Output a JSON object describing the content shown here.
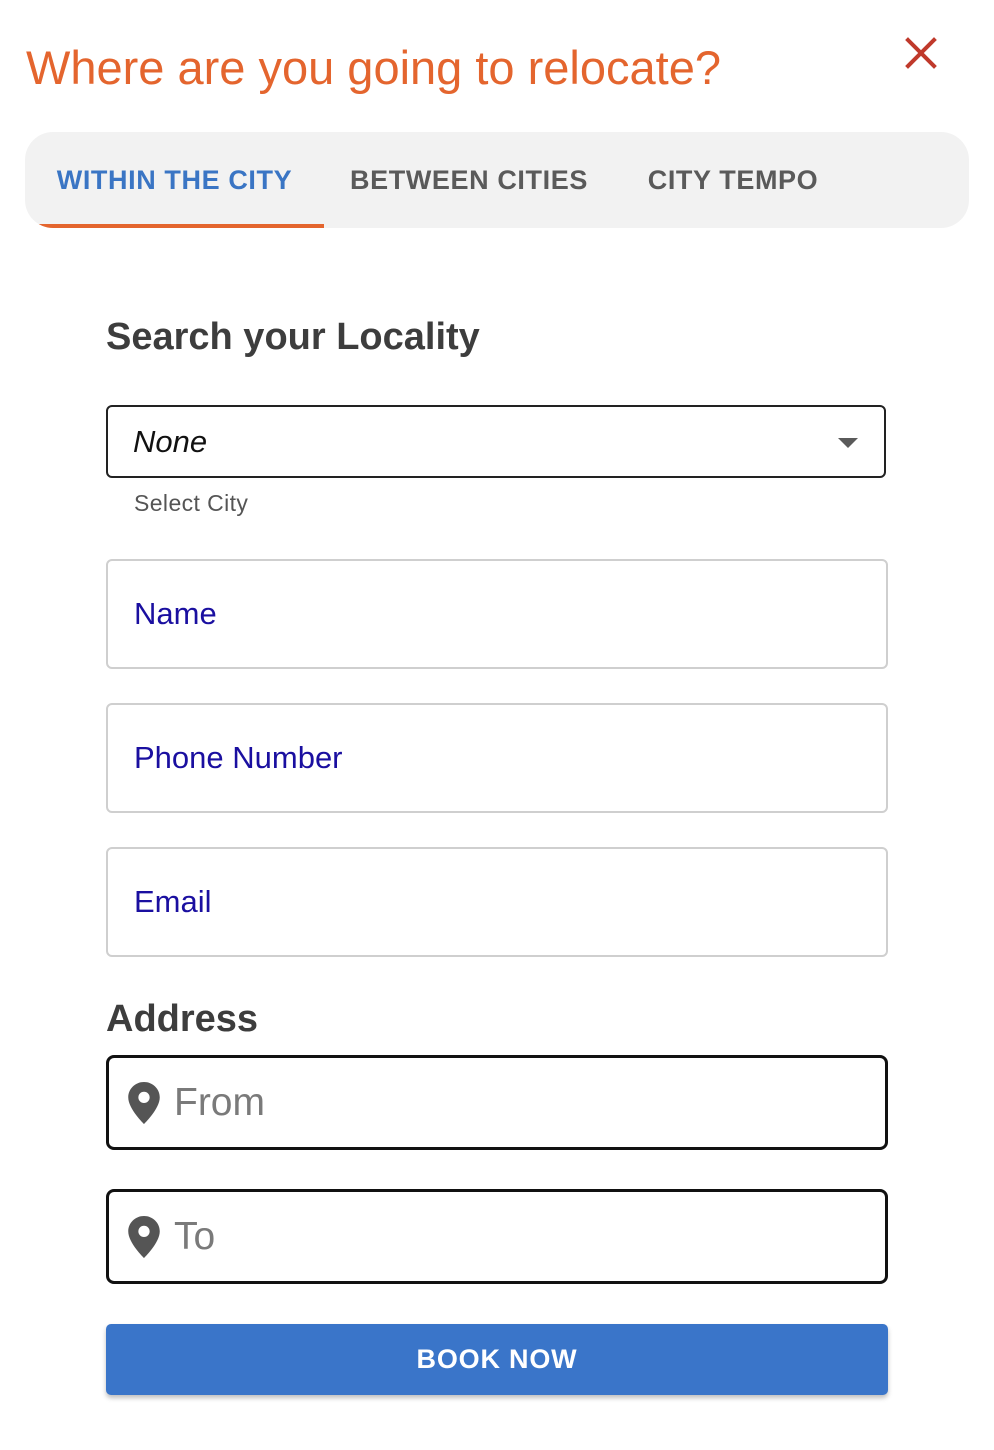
{
  "dialog": {
    "title": "Where are you going to relocate?",
    "close_icon": "close-icon"
  },
  "tabs": [
    {
      "label": "WITHIN THE CITY",
      "active": true
    },
    {
      "label": "BETWEEN CITIES",
      "active": false
    },
    {
      "label": "CITY TEMPO",
      "active": false
    }
  ],
  "locality": {
    "heading": "Search your Locality",
    "city_select": {
      "value": "None",
      "helper": "Select City",
      "icon": "chevron-down-icon"
    }
  },
  "contact_fields": {
    "name_label": "Name",
    "phone_label": "Phone Number",
    "email_label": "Email"
  },
  "address": {
    "heading": "Address",
    "from_placeholder": "From",
    "to_placeholder": "To",
    "icon": "map-pin-icon"
  },
  "actions": {
    "book_label": "BOOK NOW"
  },
  "colors": {
    "accent": "#e4652e",
    "primary": "#3a75c9",
    "active_tab": "#3a75c4",
    "field_label": "#1a0fa0",
    "close": "#c0392b"
  }
}
